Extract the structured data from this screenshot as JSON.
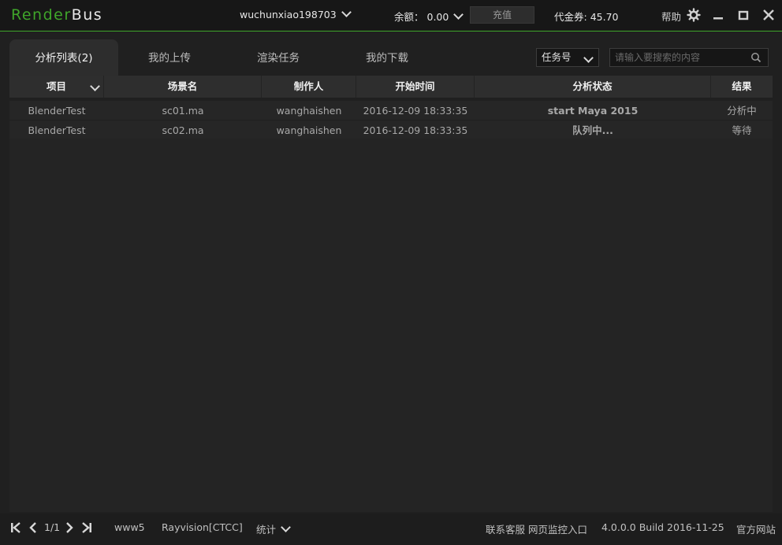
{
  "app": {
    "logo_render": "Render",
    "logo_bus": "Bus",
    "username": "wuchunxiao198703",
    "balance_label": "余额：",
    "balance_value": "0.00",
    "recharge_label": "充值",
    "voucher_label": "代金券:",
    "voucher_value": "45.70",
    "help_label": "帮助"
  },
  "tabs": [
    {
      "label": "分析列表(2)",
      "active": true
    },
    {
      "label": "我的上传",
      "active": false
    },
    {
      "label": "渲染任务",
      "active": false
    },
    {
      "label": "我的下载",
      "active": false
    }
  ],
  "search": {
    "field_selected": "任务号",
    "placeholder": "请输入要搜索的内容"
  },
  "table": {
    "columns": [
      "项目",
      "场景名",
      "制作人",
      "开始时间",
      "分析状态",
      "结果"
    ],
    "rows": [
      {
        "project": "BlenderTest",
        "scene": "sc01.ma",
        "author": "wanghaishen",
        "start_time": "2016-12-09 18:33:35",
        "status": "start Maya 2015",
        "result": "分析中"
      },
      {
        "project": "BlenderTest",
        "scene": "sc02.ma",
        "author": "wanghaishen",
        "start_time": "2016-12-09 18:33:35",
        "status": "队列中...",
        "result": "等待"
      }
    ]
  },
  "footer": {
    "page": "1/1",
    "account": "www5",
    "platform": "Rayvision[CTCC]",
    "stats_label": "统计",
    "service_label": "联系客服",
    "web_monitor_label": "网页监控入口",
    "version": "4.0.0.0 Build 2016-11-25",
    "website_label": "官方网站"
  },
  "colors": {
    "brand_green": "#3fa52a",
    "background": "#202020"
  }
}
